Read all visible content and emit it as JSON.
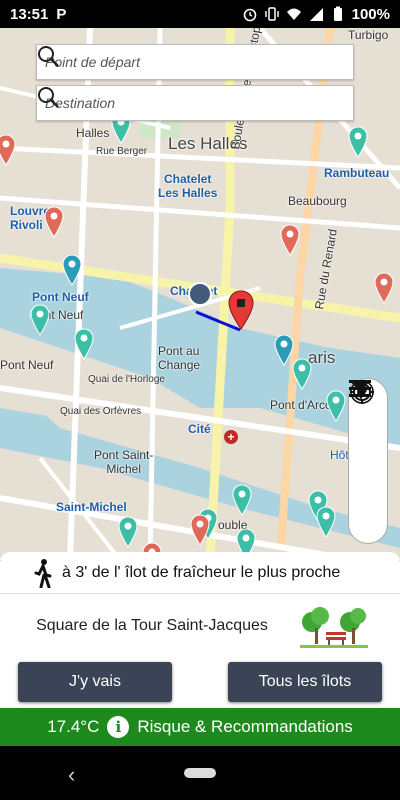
{
  "status_bar": {
    "time": "13:51",
    "app_badge": "P",
    "battery": "100%",
    "icons": [
      "alarm-icon",
      "vibrate-icon",
      "wifi-icon",
      "signal-icon",
      "battery-icon"
    ]
  },
  "search": {
    "start_placeholder": "Point de départ",
    "destination_placeholder": "Destination"
  },
  "map": {
    "labels": {
      "halles": "Halles",
      "les_halles": "Les Halles",
      "chatelet_les_halles": "Chatelet\nLes Halles",
      "rambuteau": "Rambuteau",
      "beaubourg": "Beaubourg",
      "louvre_rivoli": "Louvre\nRivoli",
      "pont_neuf_metro": "Pont Neuf",
      "pont_neuf_bridge": "Pont Neuf",
      "pont_neuf_left": "Pont Neuf",
      "chatelet": "Chatelet",
      "pont_au_change": "Pont au\nChange",
      "pont_darcole": "Pont d'Arcole",
      "cite": "Cité",
      "saint_michel": "Saint-Michel",
      "pont_saint_michel": "Pont Saint-\nMichel",
      "paris": "aris",
      "boulevard_sebastopol": "Boulevard de Sébastopol",
      "rue_du_renard": "Rue du Renard",
      "rue_berger": "Rue Berger",
      "turbigo": "Turbigo",
      "quai_horloge": "Quai de l'Horloge",
      "quai_orfevres": "Quai des Orfèvres",
      "double": "ouble",
      "hotel": "Hôt"
    }
  },
  "tools": [
    "menu-icon",
    "filter-icon",
    "ear-icon",
    "locate-icon"
  ],
  "panel": {
    "nearest_text": "à 3' de l' îlot de fraîcheur le plus proche",
    "place_name": "Square de la Tour Saint-Jacques",
    "go_button": "J'y vais",
    "all_button": "Tous les îlots"
  },
  "temp_bar": {
    "temperature": "17.4°C",
    "label": "Risque & Recommandations",
    "color": "#1e8a1e"
  },
  "colors": {
    "marker_teal": "#3cbfa6",
    "marker_red": "#e06a5a",
    "marker_blue": "#2a9bb8",
    "river": "#aad3df",
    "route": "#1010d0"
  }
}
